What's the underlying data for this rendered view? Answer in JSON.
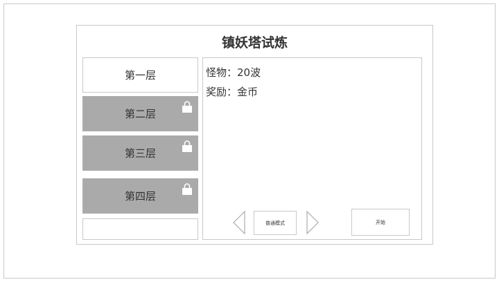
{
  "window": {
    "title": "镇妖塔试炼"
  },
  "floors": [
    {
      "label": "第一层",
      "locked": false
    },
    {
      "label": "第二层",
      "locked": true
    },
    {
      "label": "第三层",
      "locked": true
    },
    {
      "label": "第四层",
      "locked": true
    }
  ],
  "detail": {
    "monsters": "怪物：20波",
    "reward": "奖励：金币"
  },
  "mode": {
    "label": "普通模式"
  },
  "actions": {
    "start_label": "开始"
  },
  "colors": {
    "locked_bg": "#aaaaaa",
    "border": "#c8c8c8",
    "text": "#333333"
  },
  "icons": {
    "lock": "lock-icon",
    "prev": "arrow-left-icon",
    "next": "arrow-right-icon"
  }
}
